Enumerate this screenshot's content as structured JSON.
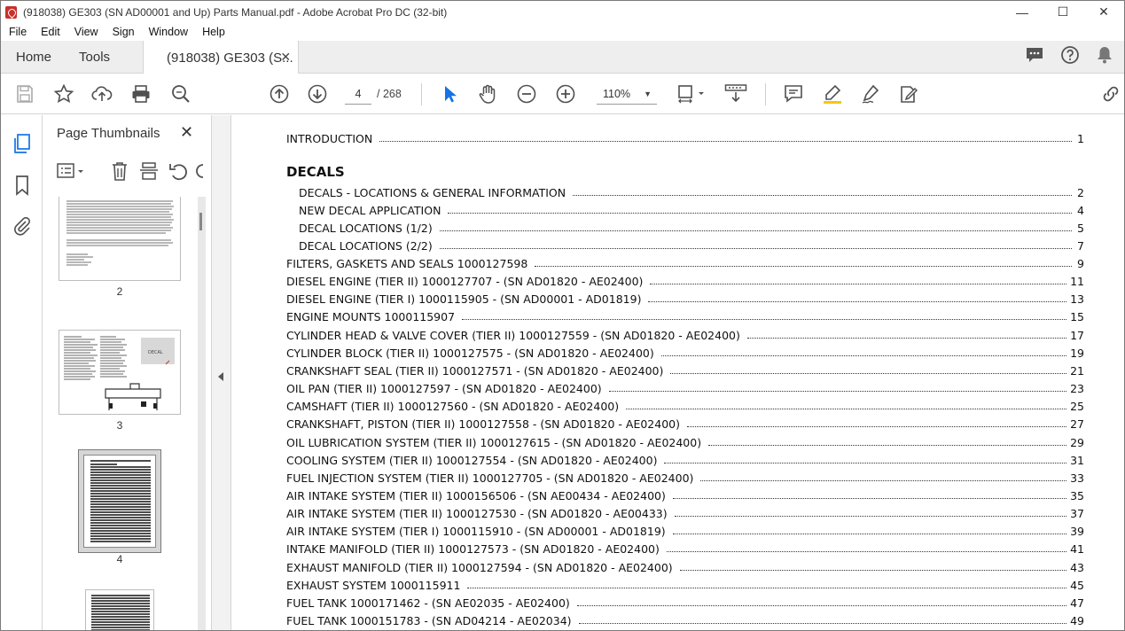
{
  "window": {
    "title": "(918038) GE303 (SN AD00001 and Up) Parts Manual.pdf - Adobe Acrobat Pro DC (32-bit)",
    "minimize": "—",
    "maximize": "☐",
    "close": "✕"
  },
  "menubar": {
    "items": [
      "File",
      "Edit",
      "View",
      "Sign",
      "Window",
      "Help"
    ]
  },
  "tabs": {
    "home": "Home",
    "tools": "Tools",
    "document": "(918038) GE303 (S...",
    "close": "✕"
  },
  "toolbar": {
    "current_page": "4",
    "total_pages": "/ 268",
    "zoom": "110%"
  },
  "thumbnails": {
    "title": "Page Thumbnails",
    "close": "✕",
    "pages": [
      "2",
      "3",
      "4"
    ]
  },
  "toc": {
    "intro": {
      "title": "INTRODUCTION",
      "page": "1"
    },
    "section_heading": "DECALS",
    "decal_rows": [
      {
        "title": "DECALS - LOCATIONS & GENERAL INFORMATION",
        "page": "2"
      },
      {
        "title": "NEW DECAL APPLICATION",
        "page": "4"
      },
      {
        "title": "DECAL LOCATIONS (1/2)",
        "page": "5"
      },
      {
        "title": "DECAL LOCATIONS (2/2)",
        "page": "7"
      }
    ],
    "rows": [
      {
        "title": "FILTERS, GASKETS AND SEALS 1000127598",
        "page": "9"
      },
      {
        "title": "DIESEL ENGINE (TIER II) 1000127707 - (SN AD01820 - AE02400)",
        "page": "11"
      },
      {
        "title": "DIESEL ENGINE (TIER I) 1000115905 - (SN AD00001 - AD01819)",
        "page": "13"
      },
      {
        "title": "ENGINE MOUNTS 1000115907",
        "page": "15"
      },
      {
        "title": "CYLINDER HEAD & VALVE COVER (TIER II) 1000127559 - (SN AD01820 - AE02400)",
        "page": "17"
      },
      {
        "title": "CYLINDER BLOCK (TIER II) 1000127575 - (SN AD01820 - AE02400)",
        "page": "19"
      },
      {
        "title": "CRANKSHAFT SEAL (TIER II) 1000127571 - (SN AD01820 - AE02400)",
        "page": "21"
      },
      {
        "title": "OIL PAN (TIER II) 1000127597 - (SN AD01820 - AE02400)",
        "page": "23"
      },
      {
        "title": "CAMSHAFT (TIER II) 1000127560 - (SN AD01820 - AE02400)",
        "page": "25"
      },
      {
        "title": "CRANKSHAFT, PISTON (TIER II) 1000127558 - (SN AD01820 - AE02400)",
        "page": "27"
      },
      {
        "title": "OIL LUBRICATION SYSTEM (TIER II) 1000127615 - (SN AD01820 - AE02400)",
        "page": "29"
      },
      {
        "title": "COOLING SYSTEM (TIER II) 1000127554 - (SN AD01820 - AE02400)",
        "page": "31"
      },
      {
        "title": "FUEL INJECTION SYSTEM (TIER II) 1000127705 - (SN AD01820 - AE02400)",
        "page": "33"
      },
      {
        "title": "AIR INTAKE SYSTEM (TIER II) 1000156506 - (SN AE00434 - AE02400)",
        "page": "35"
      },
      {
        "title": "AIR INTAKE SYSTEM (TIER II) 1000127530 - (SN AD01820 - AE00433)",
        "page": "37"
      },
      {
        "title": "AIR INTAKE SYSTEM (TIER I) 1000115910 - (SN AD00001 - AD01819)",
        "page": "39"
      },
      {
        "title": "INTAKE MANIFOLD (TIER II) 1000127573 - (SN AD01820 - AE02400)",
        "page": "41"
      },
      {
        "title": "EXHAUST MANIFOLD (TIER II) 1000127594 - (SN AD01820 - AE02400)",
        "page": "43"
      },
      {
        "title": "EXHAUST SYSTEM 1000115911",
        "page": "45"
      },
      {
        "title": "FUEL TANK 1000171462 - (SN AE02035 - AE02400)",
        "page": "47"
      },
      {
        "title": "FUEL TANK 1000151783 - (SN AD04214 - AE02034)",
        "page": "49"
      }
    ]
  },
  "colors": {
    "accent_blue": "#1473e6",
    "icon_gray": "#505050",
    "app_red": "#c9302c"
  },
  "icons": [
    "save-icon",
    "star-icon",
    "upload-icon",
    "print-icon",
    "zoom-search-icon",
    "page-up-icon",
    "page-down-icon",
    "select-arrow-icon",
    "hand-icon",
    "zoom-out-icon",
    "zoom-in-icon",
    "page-fit-icon",
    "scroll-mode-icon",
    "comment-icon",
    "highlight-icon",
    "sign-icon",
    "edit-icon",
    "link-icon",
    "chat-icon",
    "help-icon",
    "bell-icon",
    "thumbnails-icon",
    "bookmark-icon",
    "attachment-icon"
  ]
}
